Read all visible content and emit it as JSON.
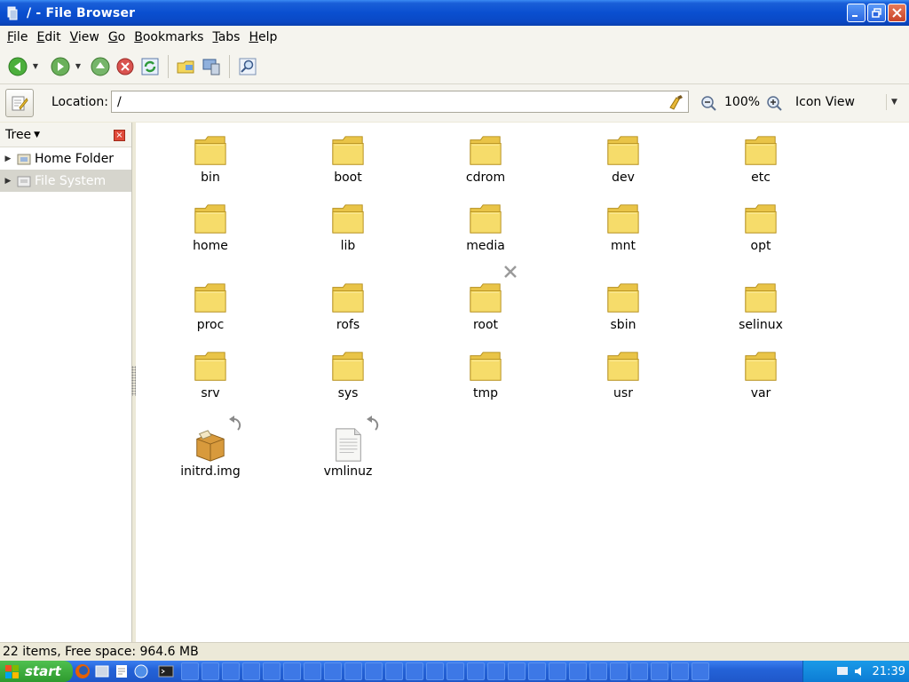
{
  "window": {
    "title": "/ - File Browser"
  },
  "menu": [
    {
      "label": "File",
      "key": "F",
      "rest": "ile"
    },
    {
      "label": "Edit",
      "key": "E",
      "rest": "dit"
    },
    {
      "label": "View",
      "key": "V",
      "rest": "iew"
    },
    {
      "label": "Go",
      "key": "G",
      "rest": "o"
    },
    {
      "label": "Bookmarks",
      "key": "B",
      "rest": "ookmarks"
    },
    {
      "label": "Tabs",
      "key": "T",
      "rest": "abs"
    },
    {
      "label": "Help",
      "key": "H",
      "rest": "elp"
    }
  ],
  "toolbar": {
    "icons": [
      "back-icon",
      "forward-icon",
      "up-icon",
      "stop-icon",
      "reload-icon",
      "home-folder-icon",
      "computer-icon",
      "search-icon"
    ]
  },
  "location": {
    "label": "Location:",
    "value": "/",
    "zoom": "100%",
    "view_mode": "Icon View"
  },
  "sidebar": {
    "header": "Tree",
    "items": [
      {
        "label": "Home Folder",
        "selected": false
      },
      {
        "label": "File System",
        "selected": true
      }
    ]
  },
  "files": [
    {
      "name": "bin",
      "type": "folder"
    },
    {
      "name": "boot",
      "type": "folder"
    },
    {
      "name": "cdrom",
      "type": "folder"
    },
    {
      "name": "dev",
      "type": "folder"
    },
    {
      "name": "etc",
      "type": "folder"
    },
    {
      "name": "home",
      "type": "folder"
    },
    {
      "name": "lib",
      "type": "folder"
    },
    {
      "name": "media",
      "type": "folder"
    },
    {
      "name": "mnt",
      "type": "folder"
    },
    {
      "name": "opt",
      "type": "folder"
    },
    {
      "name": "proc",
      "type": "folder"
    },
    {
      "name": "rofs",
      "type": "folder"
    },
    {
      "name": "root",
      "type": "folder",
      "emblem": "unreadable-emblem-icon"
    },
    {
      "name": "sbin",
      "type": "folder"
    },
    {
      "name": "selinux",
      "type": "folder"
    },
    {
      "name": "srv",
      "type": "folder"
    },
    {
      "name": "sys",
      "type": "folder"
    },
    {
      "name": "tmp",
      "type": "folder"
    },
    {
      "name": "usr",
      "type": "folder"
    },
    {
      "name": "var",
      "type": "folder"
    },
    {
      "name": "initrd.img",
      "type": "package",
      "emblem": "symlink-emblem-icon"
    },
    {
      "name": "vmlinuz",
      "type": "document",
      "emblem": "symlink-emblem-icon"
    }
  ],
  "status": {
    "text": "22 items, Free space: 964.6 MB"
  },
  "taskbar": {
    "start_label": "start",
    "clock": "21:39"
  },
  "colors": {
    "titlebar": "#0a4fd0",
    "taskbar": "#2463d8",
    "start": "#2e9a2e",
    "folder": "#f3d65a"
  }
}
